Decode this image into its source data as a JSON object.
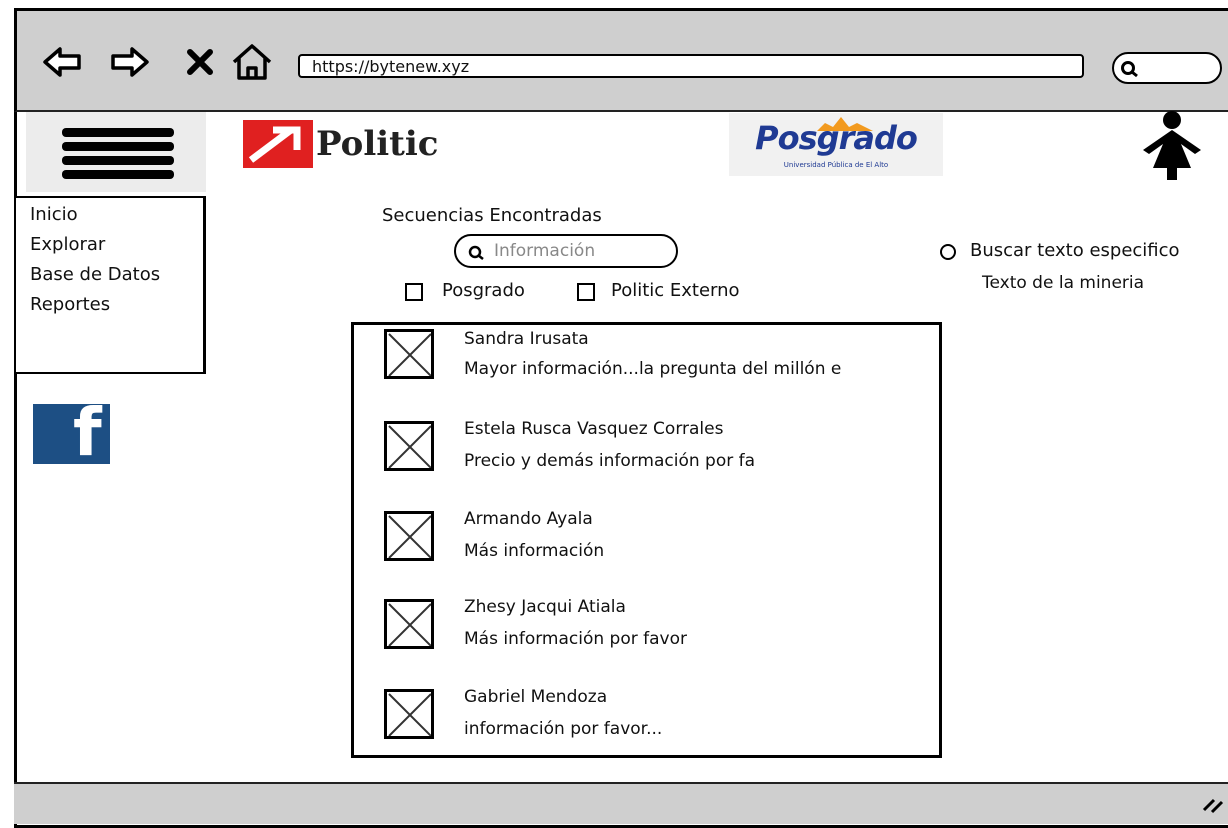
{
  "browser": {
    "url": "https://bytenew.xyz",
    "nav_icons": [
      "back-arrow-icon",
      "forward-arrow-icon",
      "close-x-icon",
      "home-icon"
    ],
    "search_icon": "search-icon"
  },
  "header": {
    "politic_logo_text": "Politic",
    "posgrado_logo": {
      "word": "Posgrado",
      "subtitle": "Universidad Pública de El Alto"
    },
    "colors": {
      "politic_red": "#e02020",
      "posgrado_blue": "#1f3a93",
      "posgrado_orange": "#f29a1f"
    }
  },
  "sidebar": {
    "items": [
      {
        "label": "Inicio"
      },
      {
        "label": "Explorar"
      },
      {
        "label": "Base de Datos"
      },
      {
        "label": "Reportes"
      }
    ],
    "social": {
      "icon": "facebook-icon",
      "color": "#1d4f84"
    }
  },
  "main": {
    "title": "Secuencias Encontradas",
    "search": {
      "placeholder": "Información"
    },
    "filters": [
      {
        "label": "Posgrado",
        "checked": false
      },
      {
        "label": "Politic Externo",
        "checked": false
      }
    ],
    "radio": {
      "label": "Buscar texto especifico",
      "selected": false
    },
    "radio_caption": "Texto de la mineria",
    "results": [
      {
        "name": "Sandra Irusata",
        "message": "Mayor información...la pregunta del millón e"
      },
      {
        "name": "Estela Rusca Vasquez Corrales",
        "message": "Precio y demás información por fa"
      },
      {
        "name": "Armando Ayala",
        "message": "Más información"
      },
      {
        "name": "Zhesy  Jacqui Atiala",
        "message": "Más información por favor"
      },
      {
        "name": "Gabriel Mendoza",
        "message": "información por favor..."
      }
    ]
  }
}
